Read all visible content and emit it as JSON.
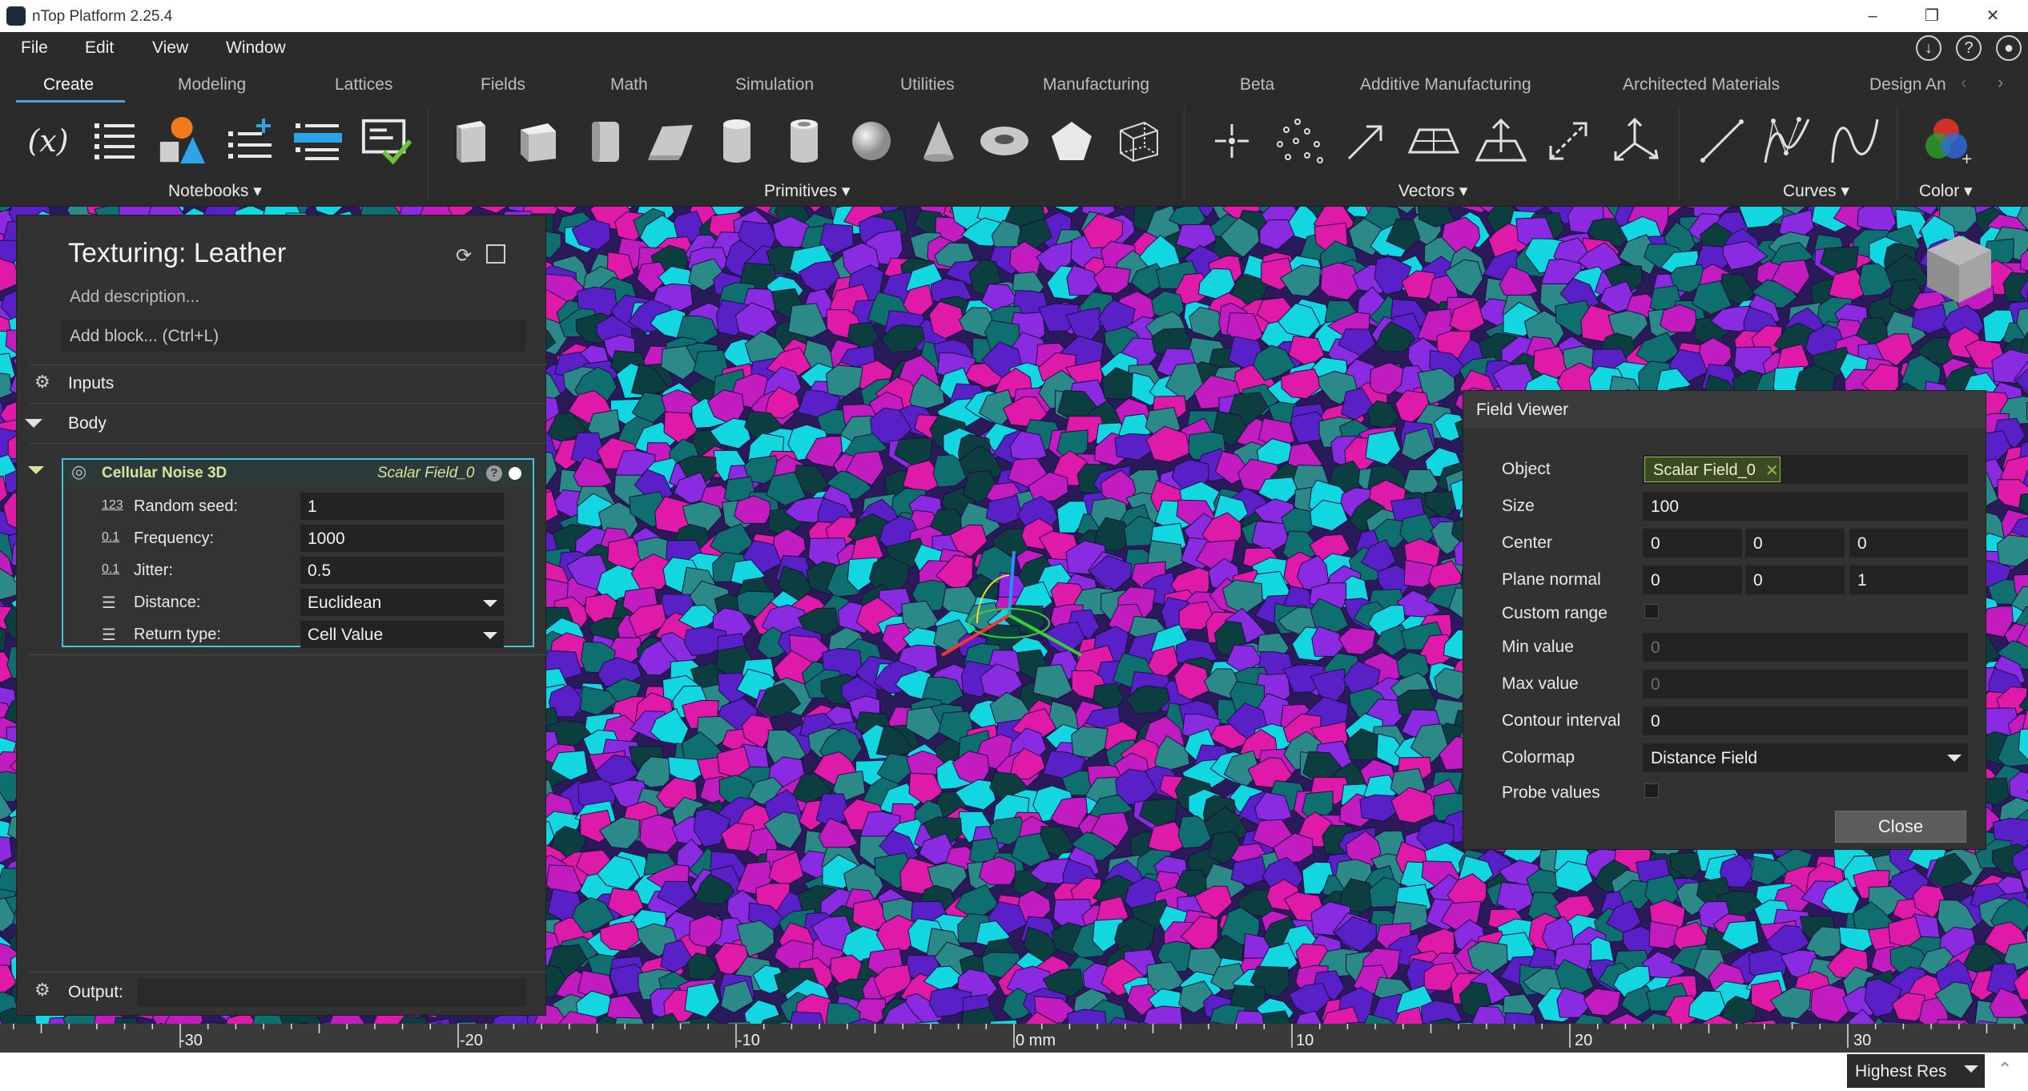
{
  "window": {
    "title": "nTop Platform 2.25.4",
    "controls": [
      "–",
      "❐",
      "✕"
    ]
  },
  "menu": [
    "File",
    "Edit",
    "View",
    "Window"
  ],
  "ribbon_tabs": [
    "Create",
    "Modeling",
    "Lattices",
    "Fields",
    "Math",
    "Simulation",
    "Utilities",
    "Manufacturing",
    "Beta",
    "Additive Manufacturing",
    "Architected Materials",
    "Design An"
  ],
  "ribbon_groups": {
    "notebooks": "Notebooks",
    "primitives": "Primitives",
    "vectors": "Vectors",
    "curves": "Curves",
    "color": "Color"
  },
  "variable_icon_text": "(x)",
  "notebook": {
    "title": "Texturing: Leather",
    "description_placeholder": "Add description...",
    "add_block": "Add block... (Ctrl+L)",
    "inputs_label": "Inputs",
    "body_label": "Body",
    "output_label": "Output:",
    "block": {
      "name": "Cellular Noise 3D",
      "output_name": "Scalar Field_0",
      "fields": [
        {
          "type_icon": "123",
          "label": "Random seed:",
          "value": "1"
        },
        {
          "type_icon": "0.1",
          "label": "Frequency:",
          "value": "1000"
        },
        {
          "type_icon": "0.1",
          "label": "Jitter:",
          "value": "0.5"
        },
        {
          "type_icon": "list",
          "label": "Distance:",
          "value": "Euclidean"
        },
        {
          "type_icon": "list",
          "label": "Return type:",
          "value": "Cell Value"
        }
      ]
    }
  },
  "field_viewer": {
    "title": "Field Viewer",
    "object_label": "Object",
    "object_value": "Scalar Field_0",
    "size_label": "Size",
    "size_value": "100",
    "center_label": "Center",
    "center": [
      "0",
      "0",
      "0"
    ],
    "plane_normal_label": "Plane normal",
    "plane_normal": [
      "0",
      "0",
      "1"
    ],
    "custom_range_label": "Custom range",
    "custom_range_checked": false,
    "min_label": "Min value",
    "min_value": "0",
    "max_label": "Max value",
    "max_value": "0",
    "contour_label": "Contour interval",
    "contour_value": "0",
    "colormap_label": "Colormap",
    "colormap_value": "Distance Field",
    "probe_label": "Probe values",
    "probe_checked": false,
    "close_label": "Close"
  },
  "ruler": {
    "labels": [
      "-30",
      "-20",
      "-10",
      "0 mm",
      "10",
      "20",
      "30"
    ]
  },
  "status": {
    "resolution": "Highest Res"
  },
  "colors": {
    "accent": "#4fa3e0",
    "block_border": "#3fc6d9",
    "block_title": "#d7e59a",
    "noise_palette": [
      "#e01aa8",
      "#8a2be2",
      "#12d6e0",
      "#0f6f6f",
      "#2b8a88",
      "#5a20c8",
      "#0c3d3f",
      "#c21cc0"
    ]
  }
}
